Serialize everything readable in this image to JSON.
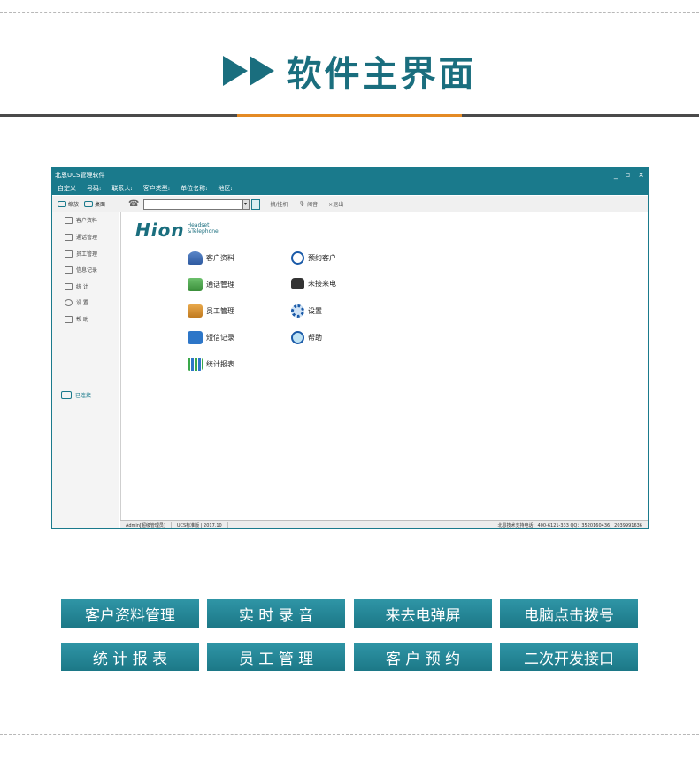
{
  "banner": {
    "title": "软件主界面"
  },
  "window": {
    "title": "北恩UCS管理软件",
    "controls": [
      "_",
      "▫",
      "×"
    ],
    "fields": [
      "自定义",
      "号码:",
      "联系人:",
      "客户类型:",
      "单位名称:",
      "地区:"
    ]
  },
  "toolbar": {
    "minimize_label": "缩放",
    "desktop_label": "桌面",
    "hangup_label": "摘/挂机",
    "mute_label": "闭音",
    "exit_label": "×退出"
  },
  "sidebar": {
    "items": [
      "客户资料",
      "通话管理",
      "员工管理",
      "信息记录",
      "统 计",
      "设 置",
      "帮 助"
    ],
    "logo_text": "已连接"
  },
  "main": {
    "brand_name": "Hion",
    "brand_sub_1": "Headset",
    "brand_sub_2": "&Telephone",
    "menu": {
      "customer": "客户资料",
      "calls": "通话管理",
      "staff": "员工管理",
      "sms": "短信记录",
      "stats": "统计报表",
      "appointment": "预约客户",
      "missed": "未接来电",
      "settings": "设置",
      "help": "帮助"
    }
  },
  "statusbar": {
    "user": "Admin[超级管理员]",
    "version": "UCS标准版 | 2017.10",
    "support": "北恩技术支持电话：400-6121-333  QQ：3520160436，2039991636"
  },
  "features": {
    "row1": [
      "客户资料管理",
      "实 时 录 音",
      "来去电弹屏",
      "电脑点击拨号"
    ],
    "row2": [
      "统 计 报 表",
      "员 工 管 理",
      "客 户 预 约",
      "二次开发接口"
    ]
  },
  "colors": {
    "brand_teal": "#1a7a8c",
    "accent_orange": "#e48a24"
  }
}
